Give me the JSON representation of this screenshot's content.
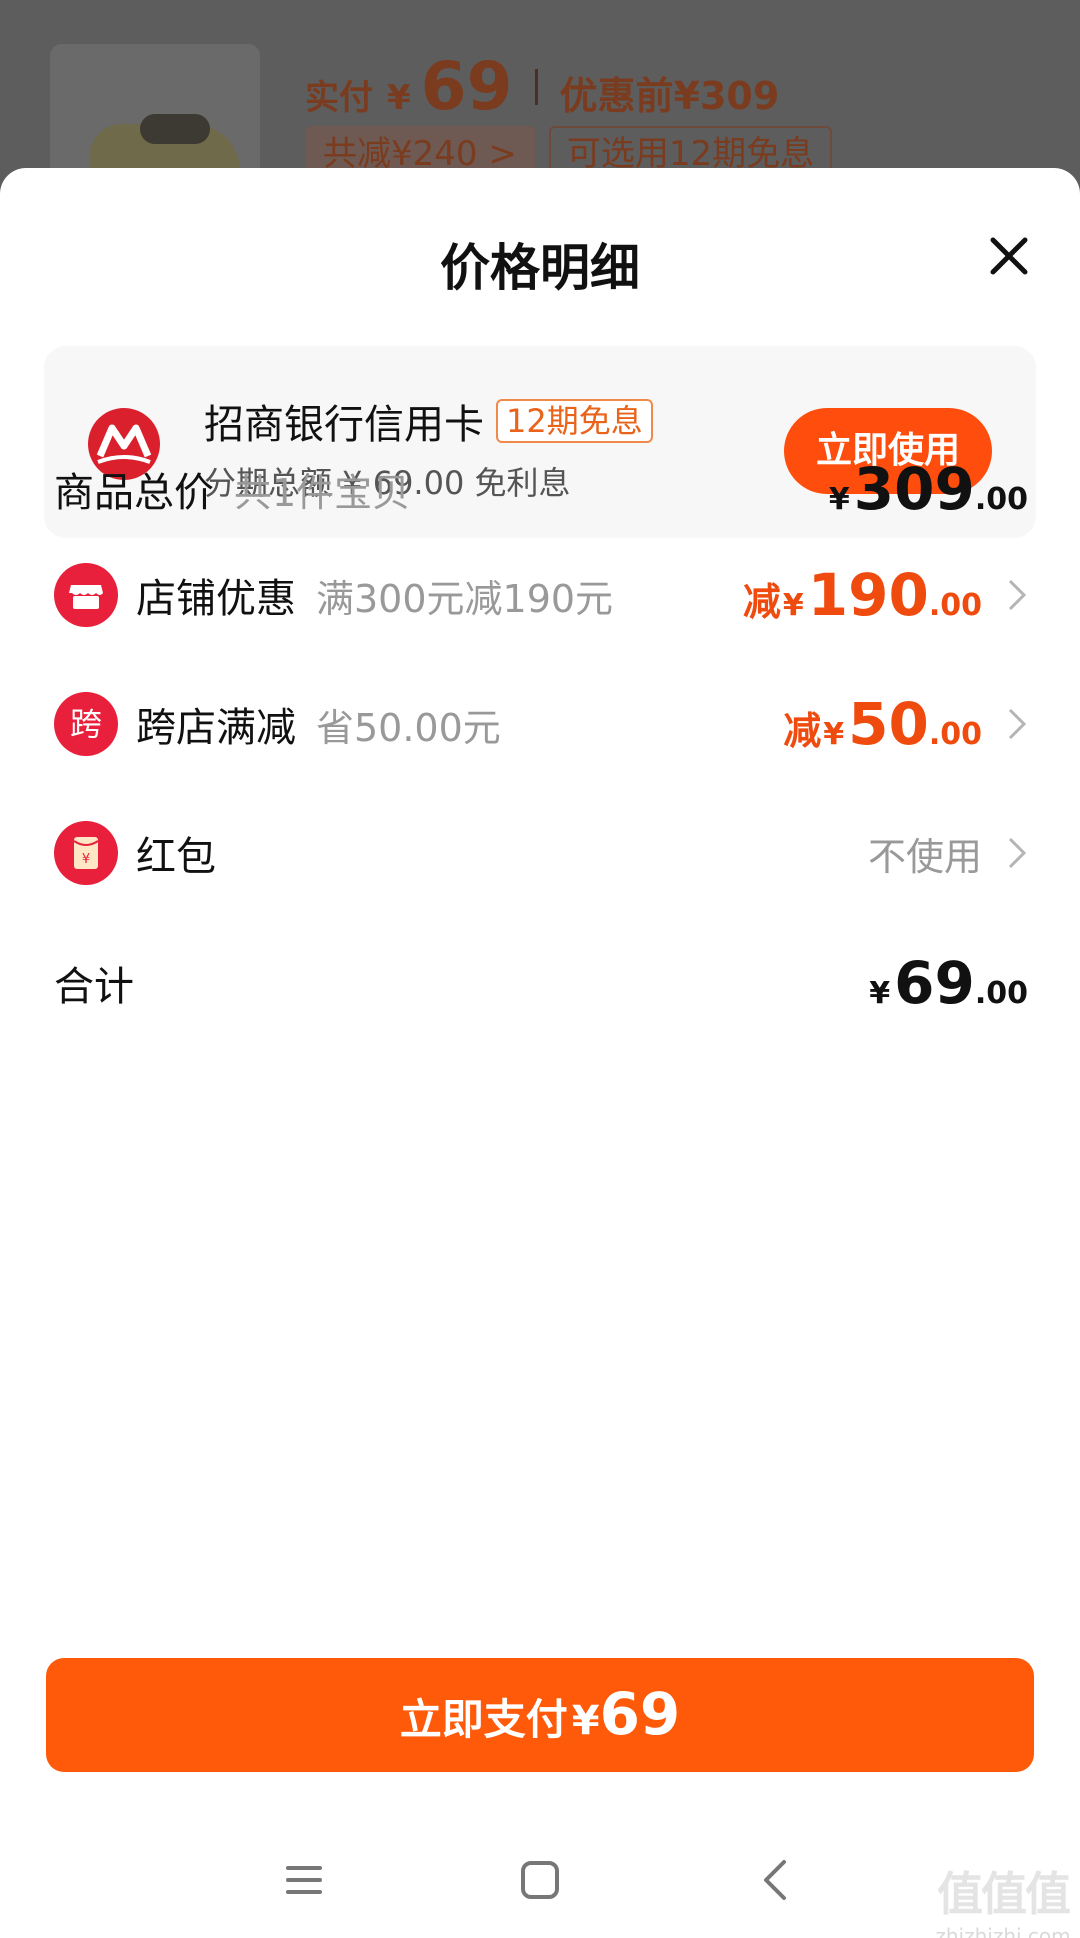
{
  "background": {
    "paid_label": "实付",
    "paid_currency": "¥",
    "paid_value": "69",
    "before_discount": "优惠前¥309",
    "chip_total_reduce": "共减¥240 >",
    "chip_installment": "可选用12期免息"
  },
  "sheet": {
    "title": "价格明细"
  },
  "promo": {
    "bank_name": "招商银行信用卡",
    "badge": "12期免息",
    "subtitle": "分期总额 ¥ 69.00 免利息",
    "button": "立即使用"
  },
  "rows": {
    "total": {
      "label": "商品总价",
      "note": "共1件宝贝",
      "yen": "¥",
      "int": "309",
      "dec": ".00"
    },
    "shop": {
      "label": "店铺优惠",
      "note": "满300元减190元",
      "prefix": "减",
      "yen": "¥",
      "int": "190",
      "dec": ".00"
    },
    "cross": {
      "label": "跨店满减",
      "note": "省50.00元",
      "icon_text": "跨",
      "prefix": "减",
      "yen": "¥",
      "int": "50",
      "dec": ".00"
    },
    "redpacket": {
      "label": "红包",
      "value": "不使用",
      "icon_text": "¥"
    },
    "sum": {
      "label": "合计",
      "yen": "¥",
      "int": "69",
      "dec": ".00"
    }
  },
  "pay": {
    "label": "立即支付",
    "yen": "¥",
    "value": "69"
  },
  "watermark": {
    "main": "值值值",
    "sub": "zhizhizhi.com"
  },
  "icons": {
    "close": "close-icon",
    "bank_logo": "cmb-logo-icon",
    "shop": "shop-icon",
    "cross": "cross-store-icon",
    "redpacket": "red-packet-icon",
    "chevron": "chevron-right-icon",
    "nav_menu": "menu-icon",
    "nav_home": "home-icon",
    "nav_back": "back-icon"
  },
  "colors": {
    "accent": "#ff5a0a",
    "discount_red": "#ef4b0f",
    "icon_red": "#e8203c"
  }
}
